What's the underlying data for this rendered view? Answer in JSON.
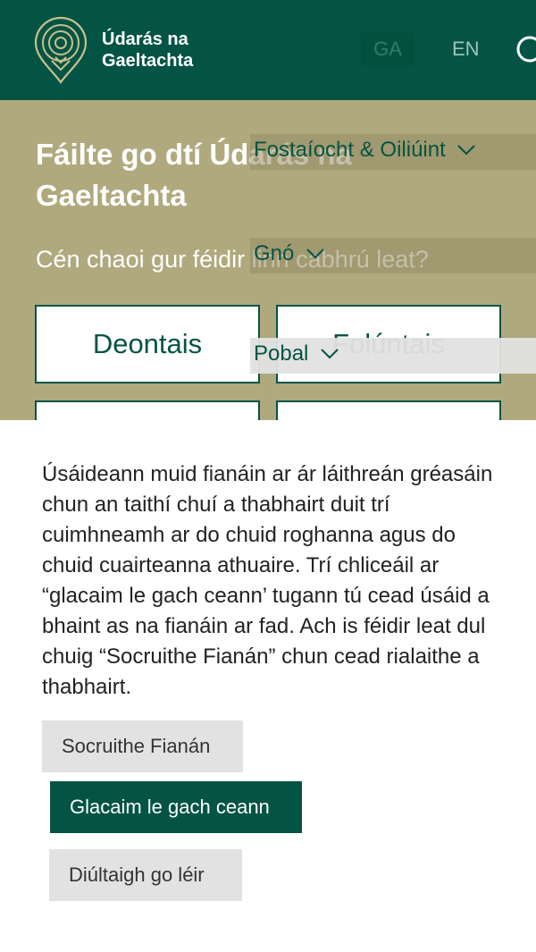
{
  "header": {
    "brand_line1": "Údarás na",
    "brand_line2": "Gaeltachta",
    "lang_ga": "GA",
    "lang_en": "EN",
    "color": "#035444"
  },
  "hero": {
    "title": "Fáilte go dtí Údarás na Gaeltachta",
    "subtitle": "Cén chaoi gur féidir linn cabhrú leat?",
    "background": "#b0a97d",
    "tiles": [
      {
        "label": "Deontais"
      },
      {
        "label": "Folúntais"
      }
    ]
  },
  "menu": {
    "items": [
      {
        "label": "Fostaíocht & Oiliúint",
        "chevron": "chevron-down-icon"
      },
      {
        "label": "Gnó",
        "chevron": "chevron-down-icon"
      },
      {
        "label": "Pobal",
        "chevron": "chevron-down-icon"
      }
    ]
  },
  "cookie": {
    "text": "Úsáideann muid fianáin ar ár láithreán gréasáin chun an taithí chuí a thabhairt duit trí cuimhneamh ar do chuid roghanna agus do chuid cuairteanna athuaire. Trí chliceáil ar “glacaim le gach ceann’ tugann tú cead úsáid a bhaint as na fianáin ar fad. Ach is féidir leat dul chuig “Socruithe Fianán” chun cead rialaithe a thabhairt.",
    "settings_label": "Socruithe Fianán",
    "accept_label": "Glacaim le gach ceann",
    "reject_label": "Diúltaigh go léir"
  }
}
